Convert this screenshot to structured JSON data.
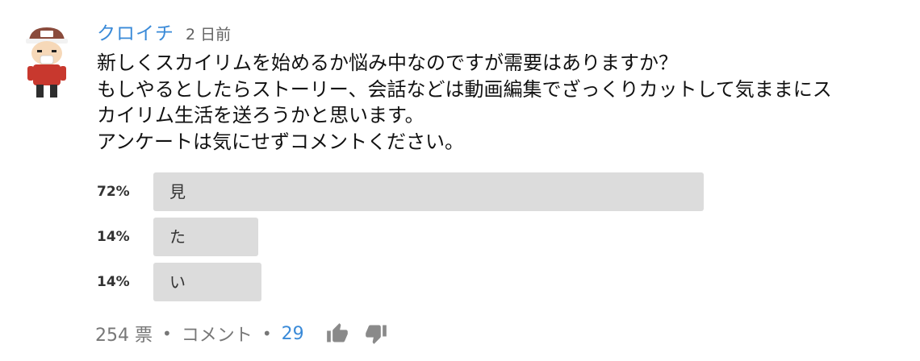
{
  "post": {
    "author": "クロイチ",
    "timestamp": "2 日前",
    "body_lines": [
      "新しくスカイリムを始めるか悩み中なのですが需要はありますか？",
      "もしやるとしたらストーリー、会話などは動画編集でざっくりカットして気ままにス",
      "カイリム生活を送ろうかと思います。",
      "アンケートは気にせずコメントください。"
    ]
  },
  "poll": {
    "options": [
      {
        "percent_label": "72%",
        "label": "見",
        "fill_percent": 72
      },
      {
        "percent_label": "14%",
        "label": "た",
        "fill_percent": 14
      },
      {
        "percent_label": "14%",
        "label": "い",
        "fill_percent": 14
      }
    ]
  },
  "footer": {
    "votes": "254 票",
    "separator": "•",
    "comments_label": "コメント",
    "comments_count": "29"
  },
  "icons": {
    "like": "thumbs-up-icon",
    "dislike": "thumbs-down-icon"
  },
  "colors": {
    "author": "#3a8ad8",
    "comment_count": "#3a8ad8",
    "poll_bar": "#dcdcdc",
    "muted_text": "#777777"
  }
}
